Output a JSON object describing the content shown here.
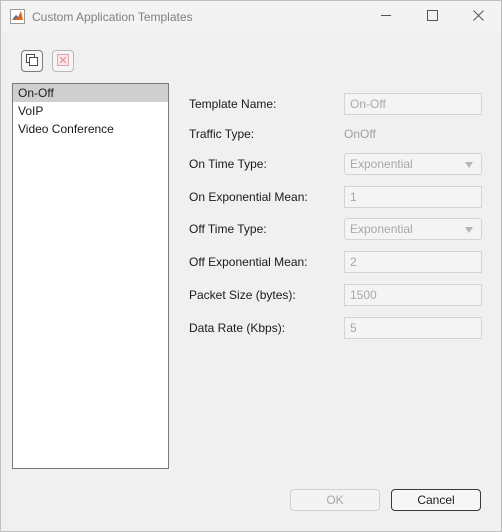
{
  "window": {
    "title": "Custom Application Templates",
    "icon": "matlab-icon",
    "controls": [
      "minimize-icon",
      "maximize-icon",
      "close-icon"
    ]
  },
  "toolbar": {
    "buttons": [
      {
        "name": "duplicate-template",
        "icon": "copy-icon"
      },
      {
        "name": "delete-template",
        "icon": "delete-x-icon",
        "disabled": true
      }
    ]
  },
  "template_list": {
    "items": [
      "On-Off",
      "VoIP",
      "Video Conference"
    ],
    "selected": "On-Off"
  },
  "form": {
    "template_name": {
      "label": "Template Name:",
      "value": "On-Off"
    },
    "traffic_type": {
      "label": "Traffic Type:",
      "value": "OnOff"
    },
    "on_time_type": {
      "label": "On Time Type:",
      "value": "Exponential"
    },
    "on_exponential_mean": {
      "label": "On Exponential Mean:",
      "value": "1"
    },
    "off_time_type": {
      "label": "Off Time Type:",
      "value": "Exponential"
    },
    "off_exponential_mean": {
      "label": "Off Exponential Mean:",
      "value": "2"
    },
    "packet_size": {
      "label": "Packet Size (bytes):",
      "value": "1500"
    },
    "data_rate": {
      "label": "Data Rate (Kbps):",
      "value": "5"
    }
  },
  "footer": {
    "ok_label": "OK",
    "ok_enabled": false,
    "cancel_label": "Cancel"
  },
  "colors": {
    "selection": "#cfcfcf",
    "disabled_text": "#a8a8a8",
    "background": "#f0f0f0"
  }
}
